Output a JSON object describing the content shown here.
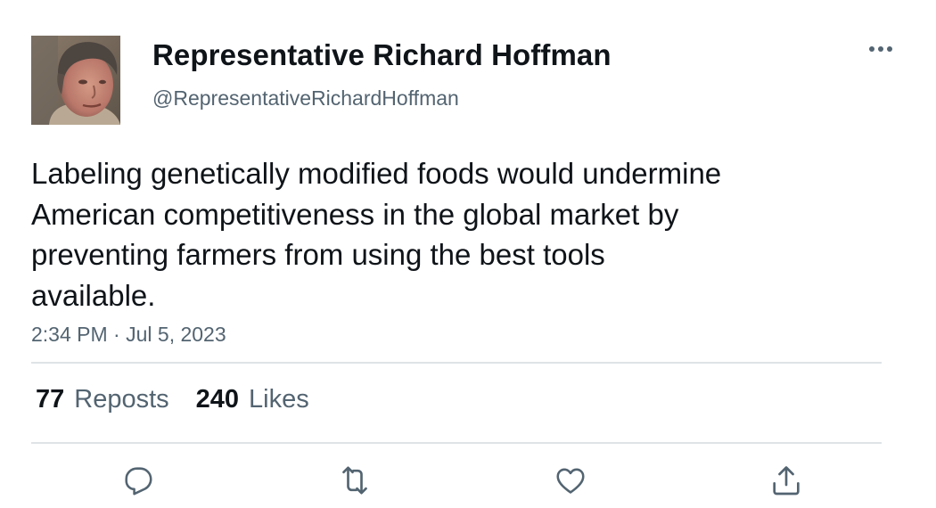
{
  "author": {
    "display_name": "Representative Richard Hoffman",
    "handle": "@RepresentativeRichardHoffman"
  },
  "tweet": {
    "text": "Labeling genetically modified foods would undermine\nAmerican competitiveness in the global market by\npreventing farmers from using the best tools\navailable.",
    "time": "2:34 PM",
    "separator": "·",
    "date": "Jul 5, 2023"
  },
  "stats": {
    "reposts_count": "77",
    "reposts_label": "Reposts",
    "likes_count": "240",
    "likes_label": "Likes"
  },
  "icons": {
    "more": "more-horizontal-icon",
    "reply": "reply-icon",
    "repost": "repost-icon",
    "like": "heart-icon",
    "share": "share-icon"
  },
  "colors": {
    "text_primary": "#0f1419",
    "text_secondary": "#536471",
    "divider": "#dfe3e6"
  }
}
